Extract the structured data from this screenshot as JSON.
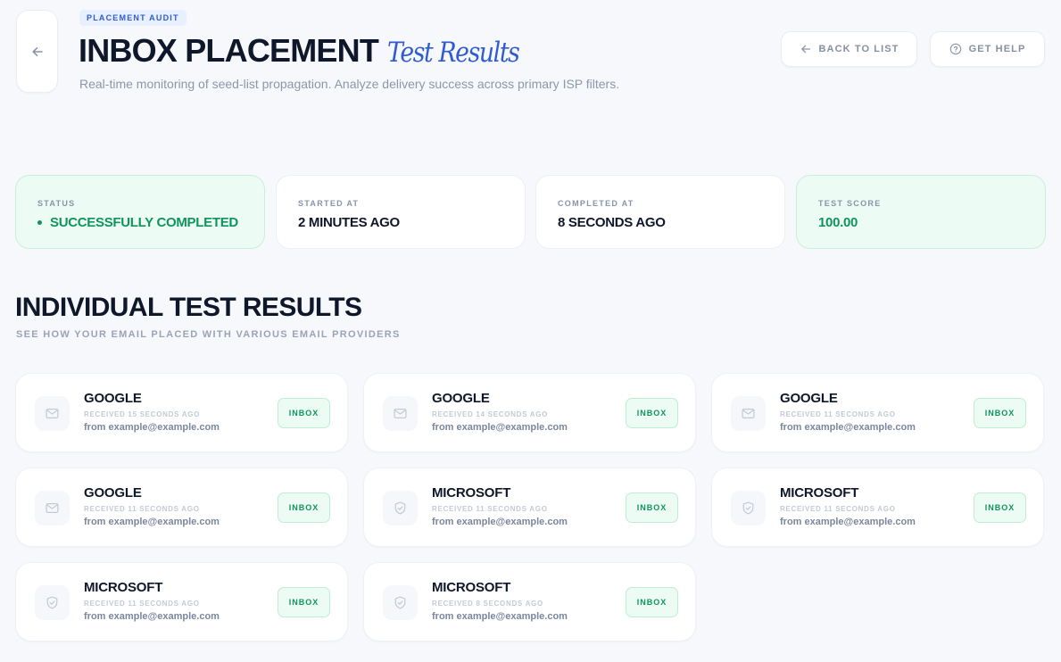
{
  "header": {
    "eyebrow": "PLACEMENT AUDIT",
    "title": "INBOX PLACEMENT",
    "title_accent": "Test Results",
    "subtitle": "Real-time monitoring of seed-list propagation. Analyze delivery success across primary ISP filters.",
    "back_to_list_label": "BACK TO LIST",
    "get_help_label": "GET HELP"
  },
  "stats": [
    {
      "label": "STATUS",
      "value": "SUCCESSFULLY COMPLETED"
    },
    {
      "label": "STARTED AT",
      "value": "2 MINUTES AGO"
    },
    {
      "label": "COMPLETED AT",
      "value": "8 SECONDS AGO"
    },
    {
      "label": "TEST SCORE",
      "value": "100.00"
    }
  ],
  "section": {
    "title": "INDIVIDUAL TEST RESULTS",
    "subtitle": "SEE HOW YOUR EMAIL PLACED WITH VARIOUS EMAIL PROVIDERS"
  },
  "results": [
    {
      "provider": "GOOGLE",
      "icon": "mail-icon",
      "received": "RECEIVED 15 SECONDS AGO",
      "from": "from example@example.com",
      "placement": "INBOX"
    },
    {
      "provider": "GOOGLE",
      "icon": "mail-icon",
      "received": "RECEIVED 14 SECONDS AGO",
      "from": "from example@example.com",
      "placement": "INBOX"
    },
    {
      "provider": "GOOGLE",
      "icon": "mail-icon",
      "received": "RECEIVED 11 SECONDS AGO",
      "from": "from example@example.com",
      "placement": "INBOX"
    },
    {
      "provider": "GOOGLE",
      "icon": "mail-icon",
      "received": "RECEIVED 11 SECONDS AGO",
      "from": "from example@example.com",
      "placement": "INBOX"
    },
    {
      "provider": "MICROSOFT",
      "icon": "shield-check-icon",
      "received": "RECEIVED 11 SECONDS AGO",
      "from": "from example@example.com",
      "placement": "INBOX"
    },
    {
      "provider": "MICROSOFT",
      "icon": "shield-check-icon",
      "received": "RECEIVED 11 SECONDS AGO",
      "from": "from example@example.com",
      "placement": "INBOX"
    },
    {
      "provider": "MICROSOFT",
      "icon": "shield-check-icon",
      "received": "RECEIVED 11 SECONDS AGO",
      "from": "from example@example.com",
      "placement": "INBOX"
    },
    {
      "provider": "MICROSOFT",
      "icon": "shield-check-icon",
      "received": "RECEIVED 8 SECONDS AGO",
      "from": "from example@example.com",
      "placement": "INBOX"
    }
  ],
  "colors": {
    "accent": "#2f5bd3",
    "success": "#10945e",
    "success_bg": "#ecfbf3",
    "page_bg": "#f6f8fb"
  }
}
